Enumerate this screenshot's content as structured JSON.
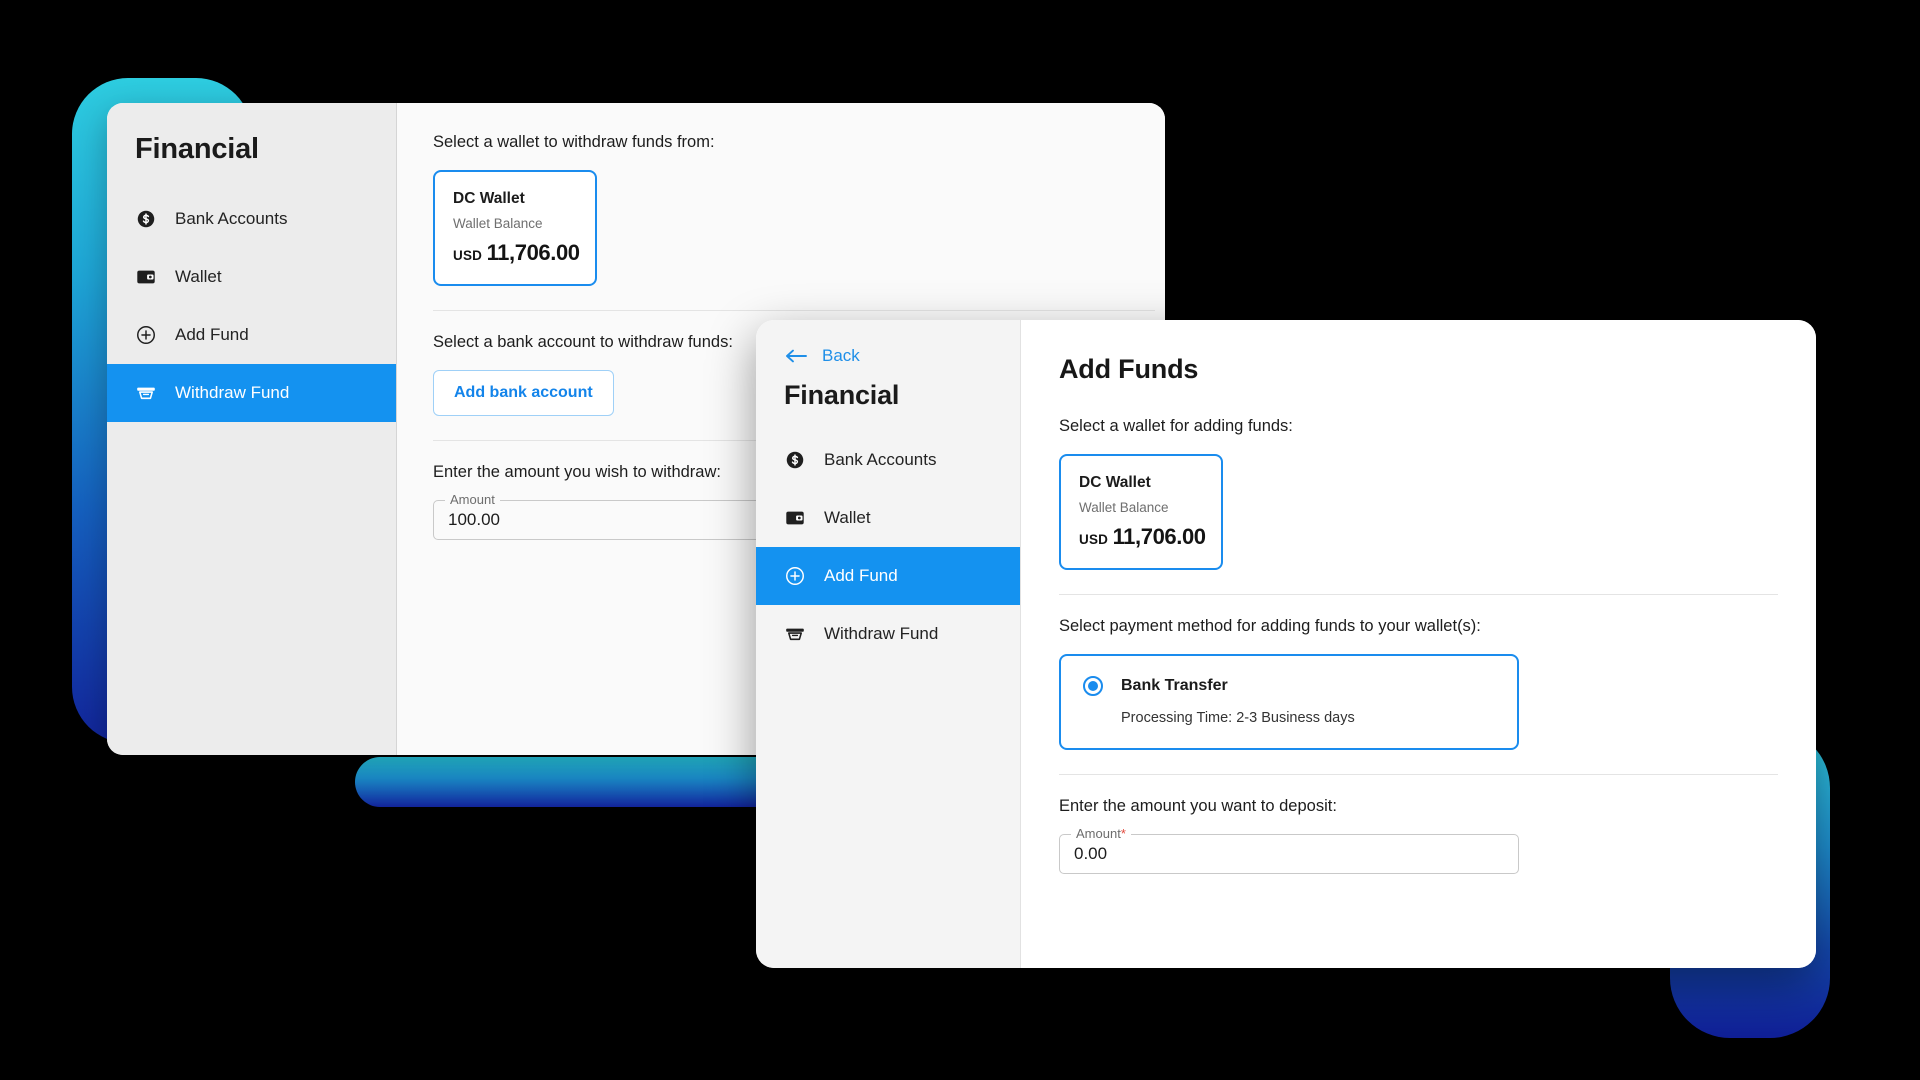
{
  "theme": {
    "accent": "#1492f0",
    "accent_border": "#1a8cee",
    "link": "#1f8fe8",
    "required_asterisk": "#e24a3c",
    "sidebar_bg": "#ececec",
    "gradient_from": "#2ecde0",
    "gradient_to": "#12259b"
  },
  "withdraw_window": {
    "sidebar": {
      "brand": "Financial",
      "items": [
        {
          "label": "Bank Accounts",
          "icon": "dollar-coin-icon",
          "active": false
        },
        {
          "label": "Wallet",
          "icon": "wallet-icon",
          "active": false
        },
        {
          "label": "Add Fund",
          "icon": "plus-circle-icon",
          "active": false
        },
        {
          "label": "Withdraw Fund",
          "icon": "atm-withdraw-icon",
          "active": true
        }
      ]
    },
    "main": {
      "wallet_prompt": "Select a wallet to withdraw funds from:",
      "wallet": {
        "name": "DC Wallet",
        "balance_label": "Wallet Balance",
        "currency": "USD",
        "amount": "11,706.00"
      },
      "bank_prompt": "Select a bank account to withdraw funds:",
      "add_bank_button": "Add bank account",
      "amount_prompt": "Enter the amount you wish to withdraw:",
      "amount_field": {
        "label": "Amount",
        "value": "100.00",
        "required": false
      }
    }
  },
  "addfunds_window": {
    "sidebar": {
      "back_label": "Back",
      "brand": "Financial",
      "items": [
        {
          "label": "Bank Accounts",
          "icon": "dollar-coin-icon",
          "active": false
        },
        {
          "label": "Wallet",
          "icon": "wallet-icon",
          "active": false
        },
        {
          "label": "Add Fund",
          "icon": "plus-circle-icon",
          "active": true
        },
        {
          "label": "Withdraw Fund",
          "icon": "atm-withdraw-icon",
          "active": false
        }
      ]
    },
    "main": {
      "title": "Add Funds",
      "wallet_prompt": "Select a wallet for adding funds:",
      "wallet": {
        "name": "DC Wallet",
        "balance_label": "Wallet Balance",
        "currency": "USD",
        "amount": "11,706.00"
      },
      "method_prompt": "Select payment method for adding funds to your wallet(s):",
      "methods": [
        {
          "name": "Bank Transfer",
          "sub": "Processing Time: 2-3 Business days",
          "selected": true
        }
      ],
      "amount_prompt": "Enter the amount you want to deposit:",
      "amount_field": {
        "label": "Amount",
        "value": "0.00",
        "required": true,
        "required_mark": "*"
      }
    }
  }
}
